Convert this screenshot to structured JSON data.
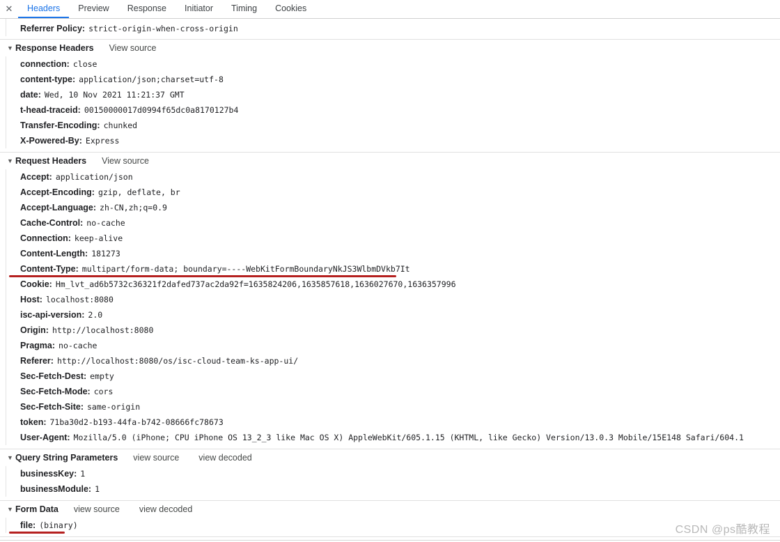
{
  "tabs": {
    "close_label": "✕",
    "items": [
      {
        "label": "Headers",
        "active": true
      },
      {
        "label": "Preview",
        "active": false
      },
      {
        "label": "Response",
        "active": false
      },
      {
        "label": "Initiator",
        "active": false
      },
      {
        "label": "Timing",
        "active": false
      },
      {
        "label": "Cookies",
        "active": false
      }
    ]
  },
  "partial_row": {
    "name": "Referrer Policy:",
    "value": "strict-origin-when-cross-origin"
  },
  "sections": [
    {
      "id": "response-headers",
      "title": "Response Headers",
      "triangle": "▼",
      "links": [
        "View source"
      ],
      "rows": [
        {
          "name": "connection:",
          "value": "close"
        },
        {
          "name": "content-type:",
          "value": "application/json;charset=utf-8"
        },
        {
          "name": "date:",
          "value": "Wed, 10 Nov 2021 11:21:37 GMT"
        },
        {
          "name": "t-head-traceid:",
          "value": "00150000017d0994f65dc0a8170127b4"
        },
        {
          "name": "Transfer-Encoding:",
          "value": "chunked"
        },
        {
          "name": "X-Powered-By:",
          "value": "Express"
        }
      ]
    },
    {
      "id": "request-headers",
      "title": "Request Headers",
      "triangle": "▼",
      "links": [
        "View source"
      ],
      "rows": [
        {
          "name": "Accept:",
          "value": "application/json"
        },
        {
          "name": "Accept-Encoding:",
          "value": "gzip, deflate, br"
        },
        {
          "name": "Accept-Language:",
          "value": "zh-CN,zh;q=0.9"
        },
        {
          "name": "Cache-Control:",
          "value": "no-cache"
        },
        {
          "name": "Connection:",
          "value": "keep-alive"
        },
        {
          "name": "Content-Length:",
          "value": "181273"
        },
        {
          "name": "Content-Type:",
          "value": "multipart/form-data; boundary=----WebKitFormBoundaryNkJS3WlbmDVkb7It",
          "annotated": true
        },
        {
          "name": "Cookie:",
          "value": "Hm_lvt_ad6b5732c36321f2dafed737ac2da92f=1635824206,1635857618,1636027670,1636357996"
        },
        {
          "name": "Host:",
          "value": "localhost:8080"
        },
        {
          "name": "isc-api-version:",
          "value": "2.0"
        },
        {
          "name": "Origin:",
          "value": "http://localhost:8080"
        },
        {
          "name": "Pragma:",
          "value": "no-cache"
        },
        {
          "name": "Referer:",
          "value": "http://localhost:8080/os/isc-cloud-team-ks-app-ui/"
        },
        {
          "name": "Sec-Fetch-Dest:",
          "value": "empty"
        },
        {
          "name": "Sec-Fetch-Mode:",
          "value": "cors"
        },
        {
          "name": "Sec-Fetch-Site:",
          "value": "same-origin"
        },
        {
          "name": "token:",
          "value": "71ba30d2-b193-44fa-b742-08666fc78673"
        },
        {
          "name": "User-Agent:",
          "value": "Mozilla/5.0 (iPhone; CPU iPhone OS 13_2_3 like Mac OS X) AppleWebKit/605.1.15 (KHTML, like Gecko) Version/13.0.3 Mobile/15E148 Safari/604.1"
        }
      ]
    },
    {
      "id": "query-string-parameters",
      "title": "Query String Parameters",
      "triangle": "▼",
      "links": [
        "view source",
        "view decoded"
      ],
      "rows": [
        {
          "name": "businessKey:",
          "value": "1"
        },
        {
          "name": "businessModule:",
          "value": "1"
        }
      ]
    },
    {
      "id": "form-data",
      "title": "Form Data",
      "triangle": "▼",
      "links": [
        "view source",
        "view decoded"
      ],
      "rows": [
        {
          "name": "file:",
          "value": "(binary)",
          "annotated": true
        }
      ]
    }
  ],
  "watermark": "CSDN @ps酷教程",
  "colors": {
    "accent": "#1a73e8",
    "annotation": "#b5201f",
    "border": "#e0e0e0",
    "text": "#202124"
  }
}
